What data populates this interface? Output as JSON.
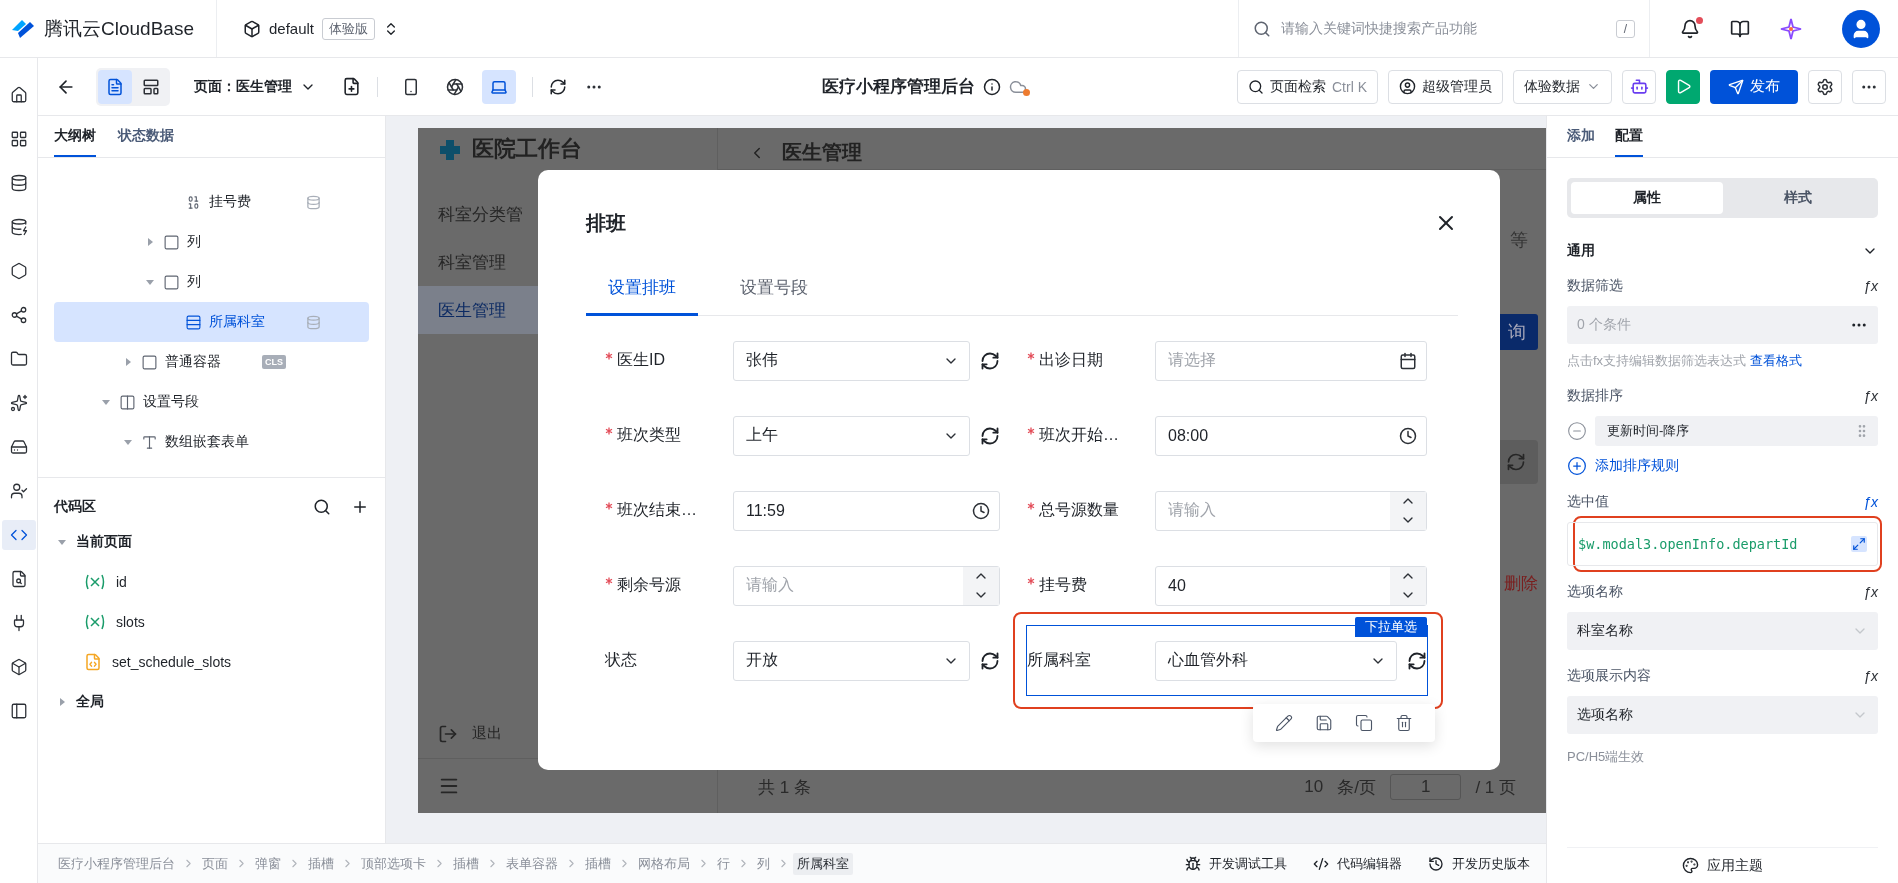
{
  "top_bar": {
    "brand": "腾讯云CloudBase",
    "env": "default",
    "env_tag": "体验版",
    "search": {
      "placeholder": "请输入关键词快捷搜索产品功能",
      "shortcut": "/"
    },
    "has_notification": true
  },
  "rail": [
    {
      "kind": "home",
      "selected": false
    },
    {
      "kind": "apps",
      "selected": false
    },
    {
      "kind": "data-model",
      "selected": false
    },
    {
      "kind": "database",
      "selected": false
    },
    {
      "kind": "function",
      "selected": false
    },
    {
      "kind": "flow",
      "selected": false
    },
    {
      "kind": "storage",
      "selected": false
    },
    {
      "kind": "ai",
      "selected": false
    },
    {
      "kind": "hosting",
      "selected": false
    },
    {
      "kind": "users",
      "selected": false
    },
    {
      "kind": "code",
      "selected": true
    },
    {
      "kind": "logs",
      "selected": false
    },
    {
      "kind": "plugin",
      "selected": false
    },
    {
      "kind": "package",
      "selected": false
    },
    {
      "kind": "panel",
      "selected": false
    }
  ],
  "toolbar": {
    "view_modes": [
      {
        "kind": "outline",
        "selected": true
      },
      {
        "kind": "layout",
        "selected": false
      }
    ],
    "page_select": "页面：医生管理",
    "devices": [
      {
        "kind": "mobile",
        "selected": false
      },
      {
        "kind": "miniprogram",
        "selected": false
      },
      {
        "kind": "desktop",
        "selected": true
      }
    ],
    "app_title": "医疗小程序管理后台",
    "unsaved": true,
    "page_search": {
      "label": "页面检索",
      "shortcut": "Ctrl K"
    },
    "role": "超级管理员",
    "data_mode": "体验数据",
    "publish": "发布"
  },
  "outline": {
    "tabs": [
      {
        "label": "大纲树",
        "selected": true
      },
      {
        "label": "状态数据",
        "selected": false
      }
    ],
    "tree": [
      {
        "children": [
          {
            "children": [
              {
                "children": [
                  {
                    "kind": "number",
                    "label": "挂号费",
                    "data_bound": true,
                    "selected": false
                  }
                ]
              },
              {
                "kind": "column",
                "label": "列",
                "expanded": false,
                "selected": false
              },
              {
                "kind": "column",
                "label": "列",
                "expanded": true,
                "selected": false,
                "children": [
                  {
                    "kind": "select",
                    "label": "所属科室",
                    "data_bound": true,
                    "selected": true
                  }
                ]
              }
            ]
          },
          {
            "kind": "container",
            "label": "普通容器",
            "expanded": false,
            "tag": "CLS",
            "selected": false
          }
        ]
      },
      {
        "kind": "tab",
        "label": "设置号段",
        "expanded": true,
        "selected": false,
        "children": [
          {
            "kind": "text",
            "label": "数组嵌套表单",
            "expanded": true,
            "selected": false
          }
        ]
      }
    ]
  },
  "code_area": {
    "title": "代码区",
    "groups": [
      {
        "label": "当前页面",
        "expanded": true,
        "items": [
          {
            "kind": "variable",
            "label": "id"
          },
          {
            "kind": "variable",
            "label": "slots"
          },
          {
            "kind": "script",
            "label": "set_schedule_slots"
          }
        ]
      },
      {
        "label": "全局",
        "expanded": false
      }
    ]
  },
  "preview": {
    "app_name": "医院工作台",
    "menu": [
      {
        "label": "科室分类管",
        "selected": false
      },
      {
        "label": "科室管理",
        "selected": false
      },
      {
        "label": "医生管理",
        "selected": true
      }
    ],
    "logout": "退出",
    "page_title": "医生管理",
    "filter_label": "等",
    "query_button": "询",
    "delete_link": "删除",
    "pagination": {
      "total": "共 1 条",
      "page_size": "10",
      "page_size_unit": "条/页",
      "page": "1",
      "pages": "/ 1 页"
    }
  },
  "modal": {
    "title": "排班",
    "tabs": [
      {
        "label": "设置排班",
        "selected": true
      },
      {
        "label": "设置号段",
        "selected": false
      }
    ],
    "fields": [
      {
        "label": "医生ID",
        "required": true,
        "kind": "select",
        "value": "张伟",
        "refresh": true,
        "selected": false
      },
      {
        "label": "出诊日期",
        "required": true,
        "kind": "date",
        "placeholder": "请选择",
        "refresh": false,
        "selected": false
      },
      {
        "label": "班次类型",
        "required": true,
        "kind": "select",
        "value": "上午",
        "refresh": true,
        "selected": false
      },
      {
        "label": "班次开始…",
        "required": true,
        "kind": "time",
        "value": "08:00",
        "refresh": false,
        "selected": false
      },
      {
        "label": "班次结束…",
        "required": true,
        "kind": "time",
        "value": "11:59",
        "refresh": false,
        "selected": false
      },
      {
        "label": "总号源数量",
        "required": true,
        "kind": "number",
        "placeholder": "请输入",
        "refresh": false,
        "selected": false
      },
      {
        "label": "剩余号源",
        "required": true,
        "kind": "number",
        "placeholder": "请输入",
        "refresh": false,
        "selected": false
      },
      {
        "label": "挂号费",
        "required": true,
        "kind": "number",
        "value": "40",
        "refresh": false,
        "selected": false
      },
      {
        "label": "状态",
        "required": false,
        "kind": "select",
        "value": "开放",
        "refresh": true,
        "selected": false
      },
      {
        "label": "所属科室",
        "required": false,
        "kind": "select",
        "value": "心血管外科",
        "refresh": true,
        "selected": true,
        "annotated": true
      }
    ],
    "selected_badge": "下拉单选"
  },
  "config_panel": {
    "tabs": [
      {
        "label": "添加",
        "selected": false
      },
      {
        "label": "配置",
        "selected": true
      }
    ],
    "segments": [
      {
        "label": "属性",
        "selected": true
      },
      {
        "label": "样式",
        "selected": false
      }
    ],
    "section": {
      "title": "通用",
      "expanded": true
    },
    "props": [
      {
        "kind": "filter",
        "label": "数据筛选",
        "fx": "ƒx",
        "bound": false,
        "value": "0 个条件",
        "hint": "点击fx支持编辑数据筛选表达式",
        "hint_link": "查看格式"
      },
      {
        "kind": "sort",
        "label": "数据排序",
        "fx": "ƒx",
        "bound": false,
        "value": "更新时间-降序",
        "add_label": "添加排序规则"
      },
      {
        "kind": "code",
        "label": "选中值",
        "fx": "ƒx",
        "bound": true,
        "value": "$w.modal3.openInfo.departId",
        "annotated": true
      },
      {
        "kind": "select",
        "label": "选项名称",
        "fx": "ƒx",
        "bound": false,
        "value": "科室名称"
      },
      {
        "kind": "select",
        "label": "选项展示内容",
        "fx": "ƒx",
        "bound": false,
        "value": "选项名称"
      },
      {
        "kind": "heading",
        "label": "PC/H5端生效"
      }
    ],
    "theme_button": "应用主题"
  },
  "breadcrumb": [
    {
      "label": "医疗小程序管理后台",
      "selected": false
    },
    {
      "label": "页面",
      "selected": false
    },
    {
      "label": "弹窗",
      "selected": false
    },
    {
      "label": "插槽",
      "selected": false
    },
    {
      "label": "顶部选项卡",
      "selected": false
    },
    {
      "label": "插槽",
      "selected": false
    },
    {
      "label": "表单容器",
      "selected": false
    },
    {
      "label": "插槽",
      "selected": false
    },
    {
      "label": "网格布局",
      "selected": false
    },
    {
      "label": "行",
      "selected": false
    },
    {
      "label": "列",
      "selected": false
    },
    {
      "label": "所属科室",
      "selected": true
    }
  ],
  "footer_tools": [
    {
      "kind": "debug",
      "label": "开发调试工具"
    },
    {
      "kind": "code",
      "label": "代码编辑器"
    },
    {
      "kind": "history",
      "label": "开发历史版本"
    }
  ]
}
